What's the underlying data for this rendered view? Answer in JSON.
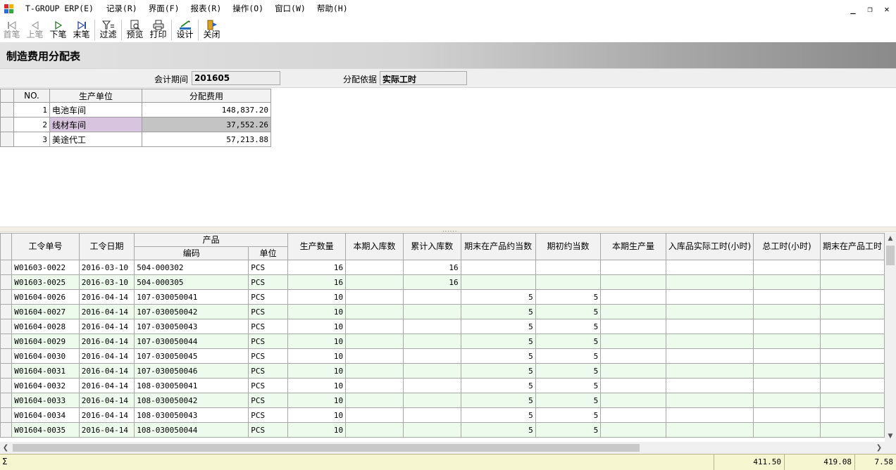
{
  "menu": {
    "app_title": "T-GROUP ERP(E)",
    "items": [
      "记录(R)",
      "界面(F)",
      "报表(R)",
      "操作(O)",
      "窗口(W)",
      "帮助(H)"
    ],
    "window_controls": [
      "_",
      "❐",
      "✕"
    ]
  },
  "toolbar": {
    "first": "首笔",
    "prev": "上笔",
    "next": "下笔",
    "last": "末笔",
    "filter": "过滤",
    "preview": "预览",
    "print": "打印",
    "design": "设计",
    "close": "关闭"
  },
  "page": {
    "title": "制造费用分配表"
  },
  "filters": {
    "period_label": "会计期间",
    "period_value": "201605",
    "basis_label": "分配依据",
    "basis_value": "实际工时"
  },
  "upper_grid": {
    "headers": [
      "NO.",
      "生产单位",
      "分配费用"
    ],
    "rows": [
      {
        "no": "1",
        "unit": "电池车间",
        "amount": "148,837.20"
      },
      {
        "no": "2",
        "unit": "线材车间",
        "amount": "37,552.26"
      },
      {
        "no": "3",
        "unit": "美途代工",
        "amount": "57,213.88"
      }
    ]
  },
  "lower_grid": {
    "headers": {
      "order_no": "工令单号",
      "order_date": "工令日期",
      "product": "产品",
      "code": "编码",
      "unit": "单位",
      "qty": "生产数量",
      "period_in": "本期入库数",
      "cum_in": "累计入库数",
      "wip_eq": "期末在产品约当数",
      "begin_eq": "期初约当数",
      "period_prod": "本期生产量",
      "actual_hours": "入库品实际工时(小时)",
      "total_hours": "总工时(小时)",
      "wip_hours": "期末在产品工时"
    },
    "rows": [
      {
        "order_no": "W01603-0022",
        "date": "2016-03-10",
        "code": "504-000302",
        "unit": "PCS",
        "qty": "16",
        "period_in": "",
        "cum_in": "16",
        "wip_eq": "",
        "begin_eq": ""
      },
      {
        "order_no": "W01603-0025",
        "date": "2016-03-10",
        "code": "504-000305",
        "unit": "PCS",
        "qty": "16",
        "period_in": "",
        "cum_in": "16",
        "wip_eq": "",
        "begin_eq": ""
      },
      {
        "order_no": "W01604-0026",
        "date": "2016-04-14",
        "code": "107-030050041",
        "unit": "PCS",
        "qty": "10",
        "period_in": "",
        "cum_in": "",
        "wip_eq": "5",
        "begin_eq": "5"
      },
      {
        "order_no": "W01604-0027",
        "date": "2016-04-14",
        "code": "107-030050042",
        "unit": "PCS",
        "qty": "10",
        "period_in": "",
        "cum_in": "",
        "wip_eq": "5",
        "begin_eq": "5"
      },
      {
        "order_no": "W01604-0028",
        "date": "2016-04-14",
        "code": "107-030050043",
        "unit": "PCS",
        "qty": "10",
        "period_in": "",
        "cum_in": "",
        "wip_eq": "5",
        "begin_eq": "5"
      },
      {
        "order_no": "W01604-0029",
        "date": "2016-04-14",
        "code": "107-030050044",
        "unit": "PCS",
        "qty": "10",
        "period_in": "",
        "cum_in": "",
        "wip_eq": "5",
        "begin_eq": "5"
      },
      {
        "order_no": "W01604-0030",
        "date": "2016-04-14",
        "code": "107-030050045",
        "unit": "PCS",
        "qty": "10",
        "period_in": "",
        "cum_in": "",
        "wip_eq": "5",
        "begin_eq": "5"
      },
      {
        "order_no": "W01604-0031",
        "date": "2016-04-14",
        "code": "107-030050046",
        "unit": "PCS",
        "qty": "10",
        "period_in": "",
        "cum_in": "",
        "wip_eq": "5",
        "begin_eq": "5"
      },
      {
        "order_no": "W01604-0032",
        "date": "2016-04-14",
        "code": "108-030050041",
        "unit": "PCS",
        "qty": "10",
        "period_in": "",
        "cum_in": "",
        "wip_eq": "5",
        "begin_eq": "5"
      },
      {
        "order_no": "W01604-0033",
        "date": "2016-04-14",
        "code": "108-030050042",
        "unit": "PCS",
        "qty": "10",
        "period_in": "",
        "cum_in": "",
        "wip_eq": "5",
        "begin_eq": "5"
      },
      {
        "order_no": "W01604-0034",
        "date": "2016-04-14",
        "code": "108-030050043",
        "unit": "PCS",
        "qty": "10",
        "period_in": "",
        "cum_in": "",
        "wip_eq": "5",
        "begin_eq": "5"
      },
      {
        "order_no": "W01604-0035",
        "date": "2016-04-14",
        "code": "108-030050044",
        "unit": "PCS",
        "qty": "10",
        "period_in": "",
        "cum_in": "",
        "wip_eq": "5",
        "begin_eq": "5"
      }
    ]
  },
  "summary": {
    "symbol": "Σ",
    "actual_hours": "411.50",
    "total_hours": "419.08",
    "wip_hours": "7.58"
  },
  "colors": {
    "selected_unit": "#d9c4e0",
    "selected_amount": "#c4c4c4",
    "alt_row": "#edfbed",
    "summary_bg": "#f6f6d0"
  }
}
